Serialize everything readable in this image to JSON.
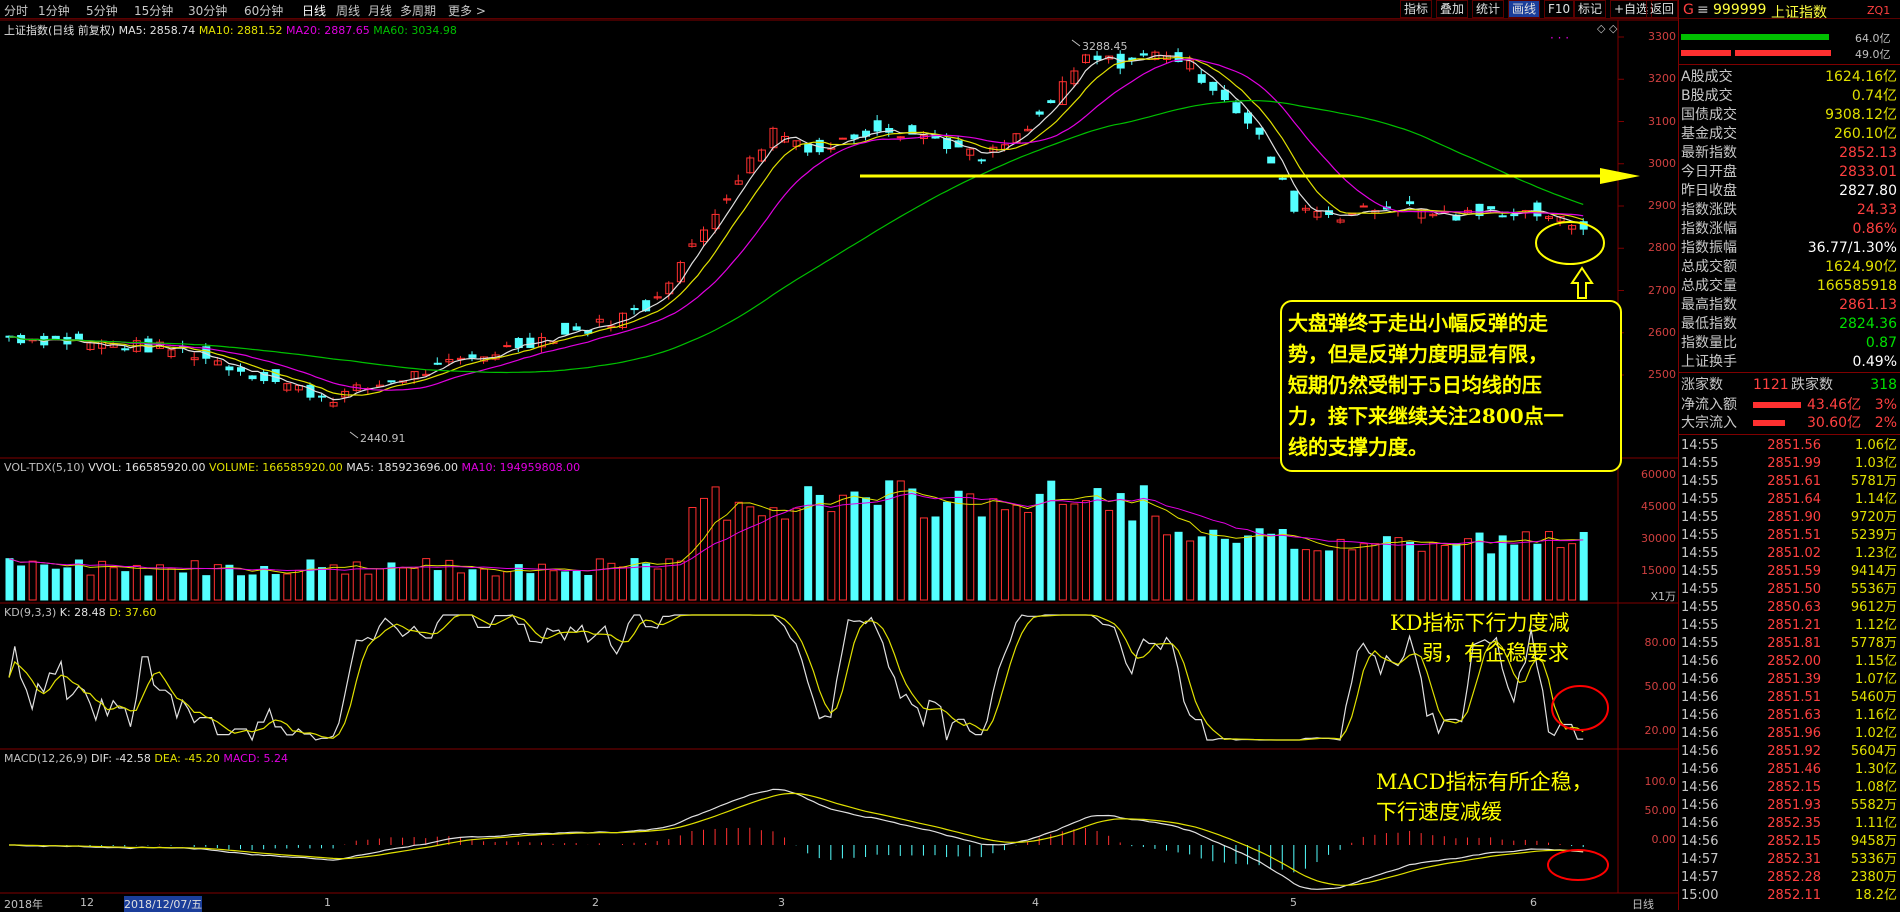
{
  "toolbar": {
    "periods": [
      "分时",
      "1分钟",
      "5分钟",
      "15分钟",
      "30分钟",
      "60分钟",
      "日线",
      "周线",
      "月线",
      "多周期",
      "更多 >"
    ],
    "active_period": "日线",
    "tools": [
      "指标",
      "叠加",
      "统计",
      "画线",
      "F10",
      "标记",
      "+自选",
      "返回"
    ],
    "active_tool": "画线"
  },
  "main_chart": {
    "title": "上证指数(日线 前复权)",
    "ma5": "MA5: 2858.74",
    "ma10": "MA10: 2881.52",
    "ma20": "MA20: 2887.65",
    "ma60": "MA60: 3034.98",
    "high_label": "3288.45",
    "low_label": "2440.91",
    "price_axis": [
      "3300",
      "3200",
      "3100",
      "3000",
      "2900",
      "2800",
      "2700",
      "2600",
      "2500"
    ]
  },
  "volume_panel": {
    "name": "VOL-TDX(5,10)",
    "vvol": "VVOL: 166585920.00",
    "volume": "VOLUME: 166585920.00",
    "ma5": "MA5: 185923696.00",
    "ma10": "MA10: 194959808.00",
    "axis": [
      "60000",
      "45000",
      "30000",
      "15000"
    ],
    "unit": "X1万"
  },
  "kd_panel": {
    "name": "KD(9,3,3)",
    "k": "K: 28.48",
    "d": "D: 37.60",
    "axis": [
      "80.00",
      "50.00",
      "20.00"
    ]
  },
  "macd_panel": {
    "name": "MACD(12,26,9)",
    "dif": "DIF: -42.58",
    "dea": "DEA: -45.20",
    "macd": "MACD: 5.24",
    "axis": [
      "100.0",
      "50.00",
      "0.00"
    ]
  },
  "x_axis": {
    "labels": [
      "2018年",
      "12",
      "2018/12/07/五",
      "1",
      "2",
      "3",
      "4",
      "5",
      "6"
    ],
    "period_label": "日线"
  },
  "annotations": {
    "main": "大盘弹终于走出小幅反弹的走势，但是反弹力度明显有限，短期仍然受制于5日均线的压力，接下来继续关注2800点一线的支撑力度。",
    "main_lines": [
      "大盘弹终于走出小幅反弹的走",
      "势，但是反弹力度明显有限，",
      "短期仍然受制于5日均线的压",
      "力，接下来继续关注2800点一",
      "线的支撑力度。"
    ],
    "kd_lines": [
      "KD指标下行力度减",
      "弱，有企稳要求"
    ],
    "macd_lines": [
      "MACD指标有所企稳，",
      "下行速度减缓"
    ]
  },
  "stock_info": {
    "prefix": "G",
    "code": "999999",
    "name": "上证指数",
    "tag": "ZQ1",
    "bar1": "64.0亿",
    "bar2": "49.0亿",
    "rows": [
      {
        "k": "A股成交",
        "v": "1624.16亿",
        "c": "#e0e000"
      },
      {
        "k": "B股成交",
        "v": "0.74亿",
        "c": "#e0e000"
      },
      {
        "k": "国债成交",
        "v": "9308.12亿",
        "c": "#e0e000"
      },
      {
        "k": "基金成交",
        "v": "260.10亿",
        "c": "#e0e000"
      },
      {
        "k": "最新指数",
        "v": "2852.13",
        "c": "#ff4040"
      },
      {
        "k": "今日开盘",
        "v": "2833.01",
        "c": "#ff4040"
      },
      {
        "k": "昨日收盘",
        "v": "2827.80",
        "c": "#ffffff"
      },
      {
        "k": "指数涨跌",
        "v": "24.33",
        "c": "#ff4040"
      },
      {
        "k": "指数涨幅",
        "v": "0.86%",
        "c": "#ff4040"
      },
      {
        "k": "指数振幅",
        "v": "36.77/1.30%",
        "c": "#ffffff"
      },
      {
        "k": "总成交额",
        "v": "1624.90亿",
        "c": "#e0e000"
      },
      {
        "k": "总成交量",
        "v": "166585918",
        "c": "#e0e000"
      },
      {
        "k": "最高指数",
        "v": "2861.13",
        "c": "#ff4040"
      },
      {
        "k": "最低指数",
        "v": "2824.36",
        "c": "#00e000"
      },
      {
        "k": "指数量比",
        "v": "0.87",
        "c": "#00e000"
      },
      {
        "k": "上证换手",
        "v": "0.49%",
        "c": "#ffffff"
      }
    ],
    "up_label": "涨家数",
    "up_count": "1121",
    "down_label": "跌家数",
    "down_count": "318",
    "netflow_label": "净流入额",
    "netflow": "43.46亿",
    "netflow_pct": "3%",
    "block_label": "大宗流入",
    "block": "30.60亿",
    "block_pct": "2%"
  },
  "ticks": [
    {
      "t": "14:55",
      "p": "2851.56",
      "v": "1.06亿"
    },
    {
      "t": "14:55",
      "p": "2851.99",
      "v": "1.03亿"
    },
    {
      "t": "14:55",
      "p": "2851.61",
      "v": "5781万"
    },
    {
      "t": "14:55",
      "p": "2851.64",
      "v": "1.14亿"
    },
    {
      "t": "14:55",
      "p": "2851.90",
      "v": "9720万"
    },
    {
      "t": "14:55",
      "p": "2851.51",
      "v": "5239万"
    },
    {
      "t": "14:55",
      "p": "2851.02",
      "v": "1.23亿"
    },
    {
      "t": "14:55",
      "p": "2851.59",
      "v": "9414万"
    },
    {
      "t": "14:55",
      "p": "2851.50",
      "v": "5536万"
    },
    {
      "t": "14:55",
      "p": "2850.63",
      "v": "9612万"
    },
    {
      "t": "14:55",
      "p": "2851.21",
      "v": "1.12亿"
    },
    {
      "t": "14:55",
      "p": "2851.81",
      "v": "5778万"
    },
    {
      "t": "14:56",
      "p": "2852.00",
      "v": "1.15亿"
    },
    {
      "t": "14:56",
      "p": "2851.39",
      "v": "1.07亿"
    },
    {
      "t": "14:56",
      "p": "2851.51",
      "v": "5460万"
    },
    {
      "t": "14:56",
      "p": "2851.63",
      "v": "1.16亿"
    },
    {
      "t": "14:56",
      "p": "2851.96",
      "v": "1.02亿"
    },
    {
      "t": "14:56",
      "p": "2851.92",
      "v": "5604万"
    },
    {
      "t": "14:56",
      "p": "2851.46",
      "v": "1.30亿"
    },
    {
      "t": "14:56",
      "p": "2852.15",
      "v": "1.08亿"
    },
    {
      "t": "14:56",
      "p": "2851.93",
      "v": "5582万"
    },
    {
      "t": "14:56",
      "p": "2852.35",
      "v": "1.11亿"
    },
    {
      "t": "14:56",
      "p": "2852.15",
      "v": "9458万"
    },
    {
      "t": "14:57",
      "p": "2852.31",
      "v": "5336万"
    },
    {
      "t": "14:57",
      "p": "2852.28",
      "v": "2380万"
    },
    {
      "t": "15:00",
      "p": "2852.11",
      "v": "18.2亿"
    }
  ]
}
